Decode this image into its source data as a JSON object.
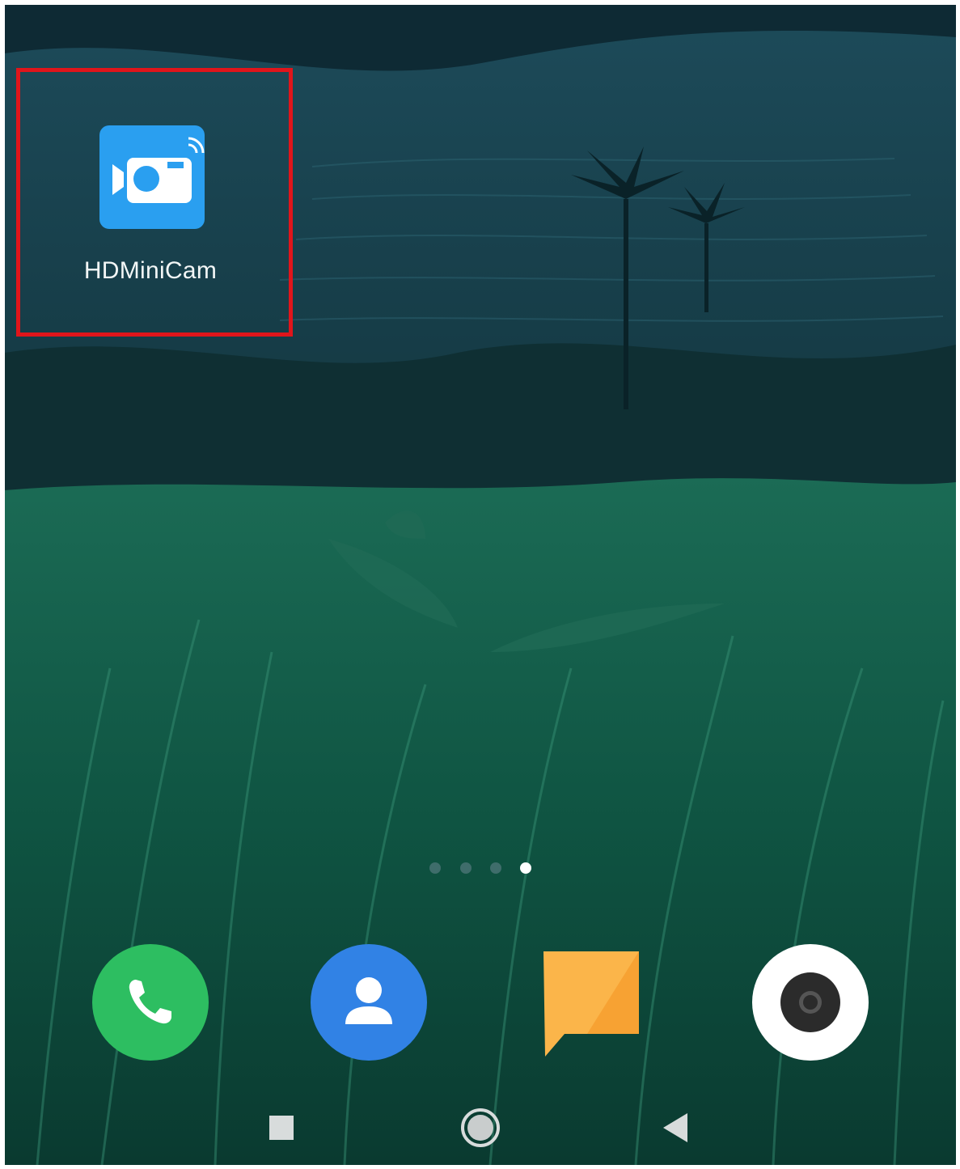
{
  "home_screen": {
    "app_icon": {
      "label": "HDMiniCam",
      "icon": "wifi-camera-icon",
      "color": "#2a9ff0"
    },
    "highlight_color": "#e0151b",
    "page_indicator": {
      "page_count": 4,
      "current_page": 4
    },
    "dock": [
      {
        "name": "phone",
        "icon": "phone-icon",
        "color": "#2dbe61"
      },
      {
        "name": "contacts",
        "icon": "contacts-icon",
        "color": "#3182e5"
      },
      {
        "name": "messages",
        "icon": "message-icon",
        "color": "#fbb54a"
      },
      {
        "name": "camera",
        "icon": "camera-icon",
        "color": "#ffffff"
      }
    ],
    "nav_bar": [
      {
        "name": "recents",
        "icon": "square-icon"
      },
      {
        "name": "home",
        "icon": "circle-icon"
      },
      {
        "name": "back",
        "icon": "triangle-back-icon"
      }
    ]
  }
}
